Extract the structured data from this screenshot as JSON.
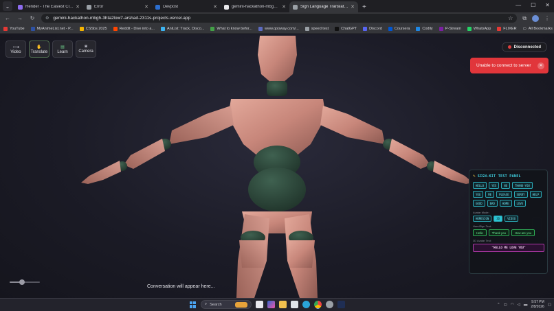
{
  "browser": {
    "tabs": [
      {
        "title": "Render - The Easiest Cloud For",
        "color": "#8e6cf0"
      },
      {
        "title": "Error",
        "color": "#9aa0a6"
      },
      {
        "title": "Devpost",
        "color": "#2c6fd0"
      },
      {
        "title": "gemini-hackathon-mbgh - Dep",
        "color": "#e8e8ec"
      },
      {
        "title": "Sign Language Translator | AI-P",
        "color": "#9aa0a6",
        "active": true
      }
    ],
    "url": "gemini-hackathon-mbgh-3hta2low7-arshad-2311s-projects.vercel.app",
    "bookmarks": [
      {
        "label": "YouTube",
        "color": "#e53935"
      },
      {
        "label": "MyAnimeList.net - P...",
        "color": "#2e51a2"
      },
      {
        "label": "CSSbs 2025",
        "color": "#f4b400"
      },
      {
        "label": "Reddit - Dive into a...",
        "color": "#ff4500"
      },
      {
        "label": "AniList: Track, Disco...",
        "color": "#3db4f2"
      },
      {
        "label": "What to know befor...",
        "color": "#43a047"
      },
      {
        "label": "www.qooway.com/...",
        "color": "#5c6bc0"
      },
      {
        "label": "speed test",
        "color": "#9aa0a6"
      },
      {
        "label": "ChatGPT",
        "color": "#111111"
      },
      {
        "label": "Discord",
        "color": "#5865f2"
      },
      {
        "label": "Coursera",
        "color": "#0056d2"
      },
      {
        "label": "Codily",
        "color": "#1e88e5"
      },
      {
        "label": "P-Stream",
        "color": "#7b1fa2"
      },
      {
        "label": "WhatsApp",
        "color": "#25d366"
      },
      {
        "label": "FLIXER",
        "color": "#e53935"
      }
    ],
    "all_bookmarks": "All Bookmarks"
  },
  "app": {
    "modes": [
      {
        "label": "Video",
        "icon": "video-icon"
      },
      {
        "label": "Translate",
        "icon": "hand-icon",
        "active": true
      },
      {
        "label": "Learn",
        "icon": "book-icon"
      },
      {
        "label": "Camera",
        "icon": "camera-icon"
      }
    ],
    "status": "Disconnected",
    "toast": "Unable to connect to server",
    "conversation_placeholder": "Conversation will appear here...",
    "speed_slider_fraction": 0.4,
    "colors": {
      "accent": "#2bc3d3",
      "error": "#e1363b",
      "skin": "#c98a7f",
      "joint": "#2f4a3d"
    }
  },
  "panel": {
    "title": "SIGN-KIT TEST PANEL",
    "signs": [
      "HELLO",
      "YES",
      "NO",
      "THANK-YOU",
      "YOU",
      "ME",
      "PLEASE",
      "SORRY",
      "HELP",
      "GOOD",
      "BAD",
      "HOME",
      "LOVE"
    ],
    "avatar_mode_label": "Avatar Mode:",
    "avatar_modes": [
      {
        "label": "HOMESIGN"
      },
      {
        "label": "3D",
        "active": true
      },
      {
        "label": "VIDEO"
      }
    ],
    "phrases_label": "HandSign Test:",
    "phrases": [
      "Hello",
      "Thank you",
      "How are you"
    ],
    "text_label": "3D Avatar Test:",
    "text_button": "\"HELLO ME LOVE YOU\""
  },
  "taskbar": {
    "search": "Search",
    "time": "9:57 PM",
    "date": "2/8/2026"
  }
}
